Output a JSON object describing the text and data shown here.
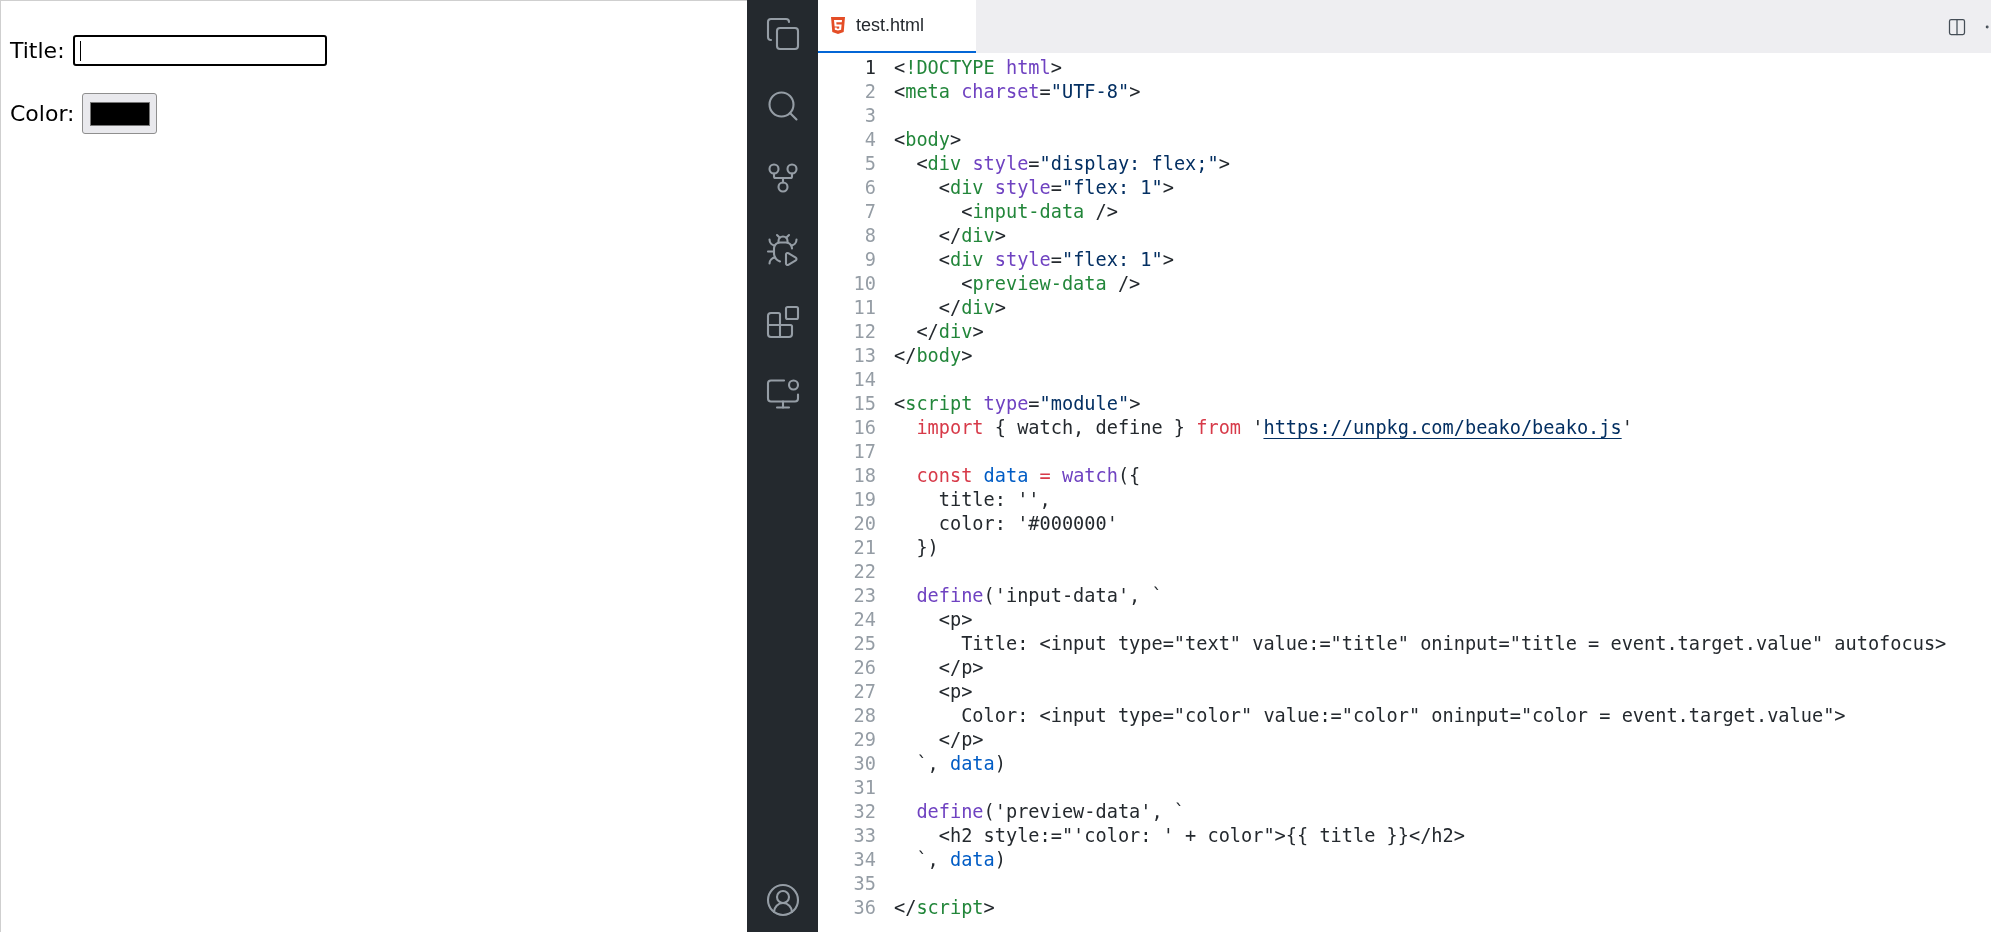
{
  "preview": {
    "fields": [
      {
        "kind": "text",
        "label": "Title:",
        "focused": true
      },
      {
        "kind": "color",
        "label": "Color:",
        "color": "#000000"
      }
    ]
  },
  "editor": {
    "tab": {
      "label": "test.html",
      "selected": true
    },
    "lines": [
      {
        "number": "1",
        "active": true,
        "tokens": [
          {
            "kind": "plain",
            "text": "<"
          },
          {
            "kind": "tag",
            "text": "!DOCTYPE"
          },
          {
            "kind": "attr",
            "text": " html"
          },
          {
            "kind": "plain",
            "text": ">"
          }
        ]
      },
      {
        "number": "2",
        "active": false,
        "tokens": [
          {
            "kind": "plain",
            "text": "<"
          },
          {
            "kind": "tag",
            "text": "meta"
          },
          {
            "kind": "attr",
            "text": " charset"
          },
          {
            "kind": "plain",
            "text": "="
          },
          {
            "kind": "string",
            "text": "\"UTF-8\""
          },
          {
            "kind": "plain",
            "text": ">"
          }
        ]
      },
      {
        "number": "3",
        "active": false
      },
      {
        "number": "4",
        "active": false,
        "tokens": [
          {
            "kind": "plain",
            "text": "<"
          },
          {
            "kind": "tag",
            "text": "body"
          },
          {
            "kind": "plain",
            "text": ">"
          }
        ]
      },
      {
        "number": "5",
        "active": false,
        "tokens": [
          {
            "kind": "plain",
            "text": "  <"
          },
          {
            "kind": "tag",
            "text": "div"
          },
          {
            "kind": "attr",
            "text": " style"
          },
          {
            "kind": "plain",
            "text": "="
          },
          {
            "kind": "string",
            "text": "\"display: flex;\""
          },
          {
            "kind": "plain",
            "text": ">"
          }
        ]
      },
      {
        "number": "6",
        "active": false,
        "tokens": [
          {
            "kind": "plain",
            "text": "    <"
          },
          {
            "kind": "tag",
            "text": "div"
          },
          {
            "kind": "attr",
            "text": " style"
          },
          {
            "kind": "plain",
            "text": "="
          },
          {
            "kind": "string",
            "text": "\"flex: 1\""
          },
          {
            "kind": "plain",
            "text": ">"
          }
        ]
      },
      {
        "number": "7",
        "active": false,
        "tokens": [
          {
            "kind": "plain",
            "text": "      <"
          },
          {
            "kind": "tag",
            "text": "input-data"
          },
          {
            "kind": "plain",
            "text": " />"
          }
        ]
      },
      {
        "number": "8",
        "active": false,
        "tokens": [
          {
            "kind": "plain",
            "text": "    </"
          },
          {
            "kind": "tag",
            "text": "div"
          },
          {
            "kind": "plain",
            "text": ">"
          }
        ]
      },
      {
        "number": "9",
        "active": false,
        "tokens": [
          {
            "kind": "plain",
            "text": "    <"
          },
          {
            "kind": "tag",
            "text": "div"
          },
          {
            "kind": "attr",
            "text": " style"
          },
          {
            "kind": "plain",
            "text": "="
          },
          {
            "kind": "string",
            "text": "\"flex: 1\""
          },
          {
            "kind": "plain",
            "text": ">"
          }
        ]
      },
      {
        "number": "10",
        "active": false,
        "tokens": [
          {
            "kind": "plain",
            "text": "      <"
          },
          {
            "kind": "tag",
            "text": "preview-data"
          },
          {
            "kind": "plain",
            "text": " />"
          }
        ]
      },
      {
        "number": "11",
        "active": false,
        "tokens": [
          {
            "kind": "plain",
            "text": "    </"
          },
          {
            "kind": "tag",
            "text": "div"
          },
          {
            "kind": "plain",
            "text": ">"
          }
        ]
      },
      {
        "number": "12",
        "active": false,
        "tokens": [
          {
            "kind": "plain",
            "text": "  </"
          },
          {
            "kind": "tag",
            "text": "div"
          },
          {
            "kind": "plain",
            "text": ">"
          }
        ]
      },
      {
        "number": "13",
        "active": false,
        "tokens": [
          {
            "kind": "plain",
            "text": "</"
          },
          {
            "kind": "tag",
            "text": "body"
          },
          {
            "kind": "plain",
            "text": ">"
          }
        ]
      },
      {
        "number": "14",
        "active": false
      },
      {
        "number": "15",
        "active": false,
        "tokens": [
          {
            "kind": "plain",
            "text": "<"
          },
          {
            "kind": "tag",
            "text": "script"
          },
          {
            "kind": "attr",
            "text": " type"
          },
          {
            "kind": "plain",
            "text": "="
          },
          {
            "kind": "string",
            "text": "\"module\""
          },
          {
            "kind": "plain",
            "text": ">"
          }
        ]
      },
      {
        "number": "16",
        "active": false,
        "tokens": [
          {
            "kind": "keyword",
            "text": "  import"
          },
          {
            "kind": "plain",
            "text": " { watch, define } "
          },
          {
            "kind": "keyword",
            "text": "from"
          },
          {
            "kind": "plain",
            "text": " '"
          },
          {
            "kind": "link",
            "text": "https://unpkg.com/beako/beako.js"
          },
          {
            "kind": "plain",
            "text": "'"
          }
        ]
      },
      {
        "number": "17",
        "active": false
      },
      {
        "number": "18",
        "active": false,
        "tokens": [
          {
            "kind": "keyword",
            "text": "  const"
          },
          {
            "kind": "variable",
            "text": " data"
          },
          {
            "kind": "keyword",
            "text": " ="
          },
          {
            "kind": "function",
            "text": " watch"
          },
          {
            "kind": "plain",
            "text": "({"
          }
        ]
      },
      {
        "number": "19",
        "active": false,
        "tokens": [
          {
            "kind": "plain",
            "text": "    title: '',"
          }
        ]
      },
      {
        "number": "20",
        "active": false,
        "tokens": [
          {
            "kind": "plain",
            "text": "    color: '#000000'"
          }
        ]
      },
      {
        "number": "21",
        "active": false,
        "tokens": [
          {
            "kind": "plain",
            "text": "  })"
          }
        ]
      },
      {
        "number": "22",
        "active": false
      },
      {
        "number": "23",
        "active": false,
        "tokens": [
          {
            "kind": "function",
            "text": "  define"
          },
          {
            "kind": "plain",
            "text": "('input-data', `"
          }
        ]
      },
      {
        "number": "24",
        "active": false,
        "tokens": [
          {
            "kind": "plain",
            "text": "    <p>"
          }
        ]
      },
      {
        "number": "25",
        "active": false,
        "tokens": [
          {
            "kind": "plain",
            "text": "      Title: <input type=\"text\" value:=\"title\" oninput=\"title = event.target.value\" autofocus>"
          }
        ]
      },
      {
        "number": "26",
        "active": false,
        "tokens": [
          {
            "kind": "plain",
            "text": "    </p>"
          }
        ]
      },
      {
        "number": "27",
        "active": false,
        "tokens": [
          {
            "kind": "plain",
            "text": "    <p>"
          }
        ]
      },
      {
        "number": "28",
        "active": false,
        "tokens": [
          {
            "kind": "plain",
            "text": "      Color: <input type=\"color\" value:=\"color\" oninput=\"color = event.target.value\">"
          }
        ]
      },
      {
        "number": "29",
        "active": false,
        "tokens": [
          {
            "kind": "plain",
            "text": "    </p>"
          }
        ]
      },
      {
        "number": "30",
        "active": false,
        "tokens": [
          {
            "kind": "plain",
            "text": "  `, "
          },
          {
            "kind": "variable",
            "text": "data"
          },
          {
            "kind": "plain",
            "text": ")"
          }
        ]
      },
      {
        "number": "31",
        "active": false
      },
      {
        "number": "32",
        "active": false,
        "tokens": [
          {
            "kind": "function",
            "text": "  define"
          },
          {
            "kind": "plain",
            "text": "('preview-data', `"
          }
        ]
      },
      {
        "number": "33",
        "active": false,
        "tokens": [
          {
            "kind": "plain",
            "text": "    <h2 style:=\"'color: ' + color\">{{ title }}</h2>"
          }
        ]
      },
      {
        "number": "34",
        "active": false,
        "tokens": [
          {
            "kind": "plain",
            "text": "  `, "
          },
          {
            "kind": "variable",
            "text": "data"
          },
          {
            "kind": "plain",
            "text": ")"
          }
        ]
      },
      {
        "number": "35",
        "active": false
      },
      {
        "number": "36",
        "active": false,
        "tokens": [
          {
            "kind": "plain",
            "text": "</"
          },
          {
            "kind": "tag",
            "text": "script"
          },
          {
            "kind": "plain",
            "text": ">"
          }
        ]
      }
    ]
  }
}
